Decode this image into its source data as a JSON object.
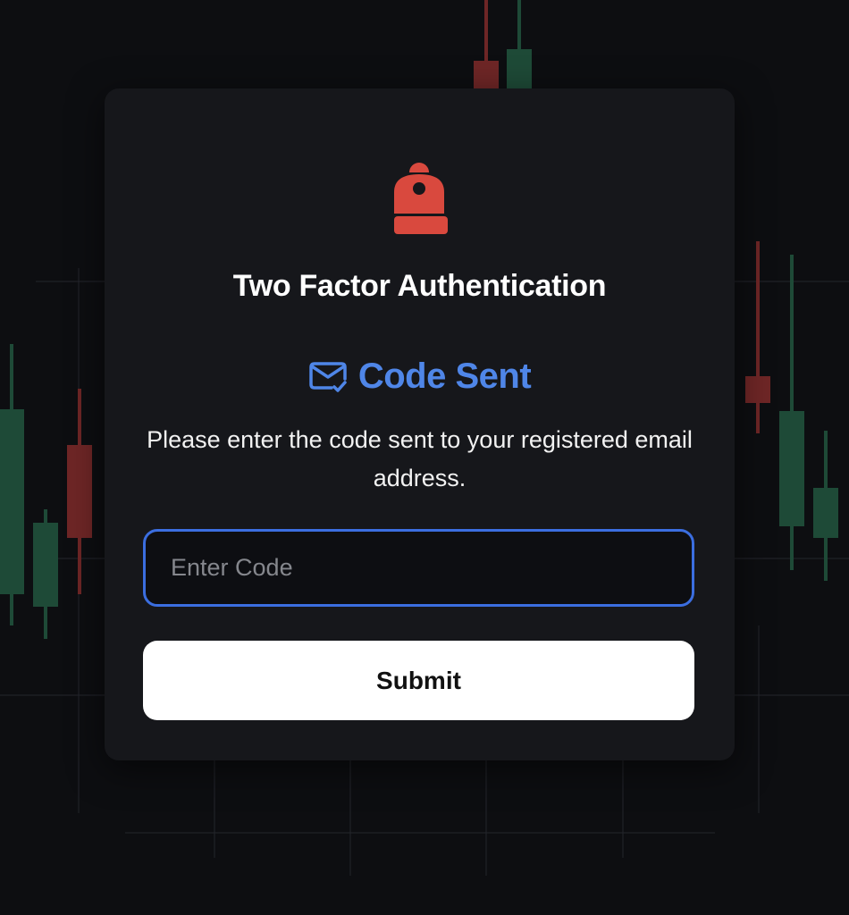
{
  "dialog": {
    "title": "Two Factor Authentication",
    "status_title": "Code Sent",
    "description": "Please enter the code sent to your registered email address.",
    "code_input": {
      "value": "",
      "placeholder": "Enter Code"
    },
    "submit_label": "Submit"
  },
  "icons": {
    "header": "lock-icon",
    "status": "mail-check-icon"
  },
  "colors": {
    "background": "#0d0e11",
    "card": "#16171b",
    "accent_blue": "#4f86e8",
    "input_border": "#3b6ee0",
    "lock_red": "#d9493e",
    "button_bg": "#ffffff",
    "candle_green": "#1e4a37",
    "candle_red": "#6e2626",
    "grid": "#24262c"
  }
}
